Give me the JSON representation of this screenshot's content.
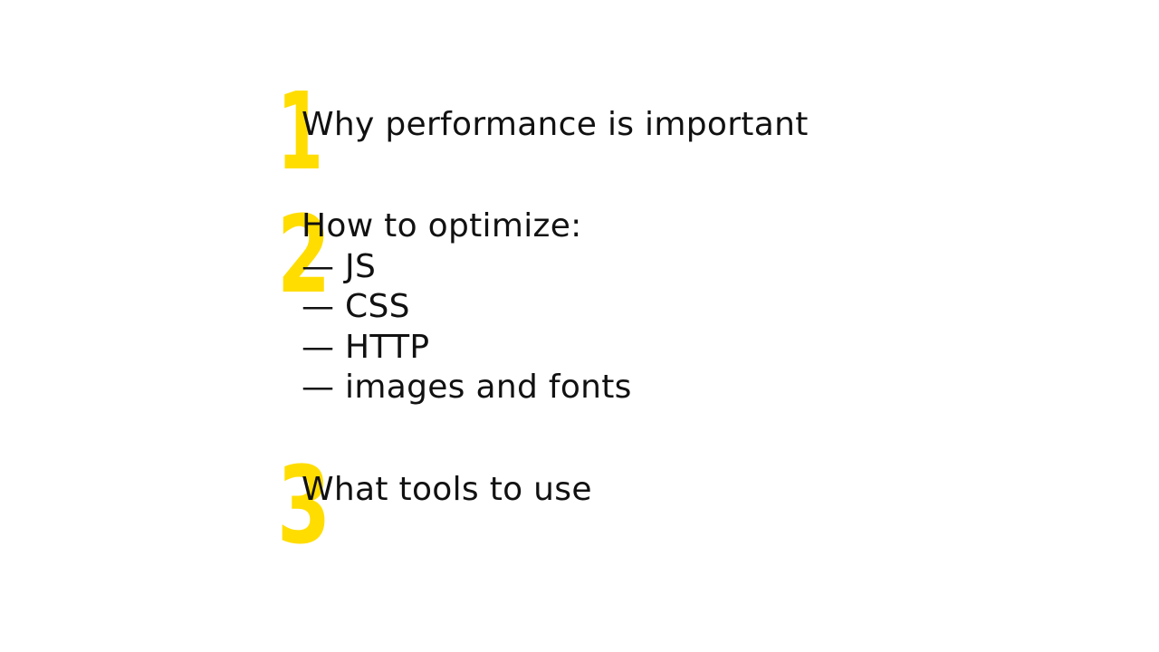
{
  "accent_color": "#ffdd00",
  "items": [
    {
      "number": "1",
      "title": "Why performance is important",
      "subitems": []
    },
    {
      "number": "2",
      "title": "How to optimize:",
      "subitems": [
        "— JS",
        "— CSS",
        "— HTTP",
        "— images and fonts"
      ]
    },
    {
      "number": "3",
      "title": "What tools to use",
      "subitems": []
    }
  ]
}
